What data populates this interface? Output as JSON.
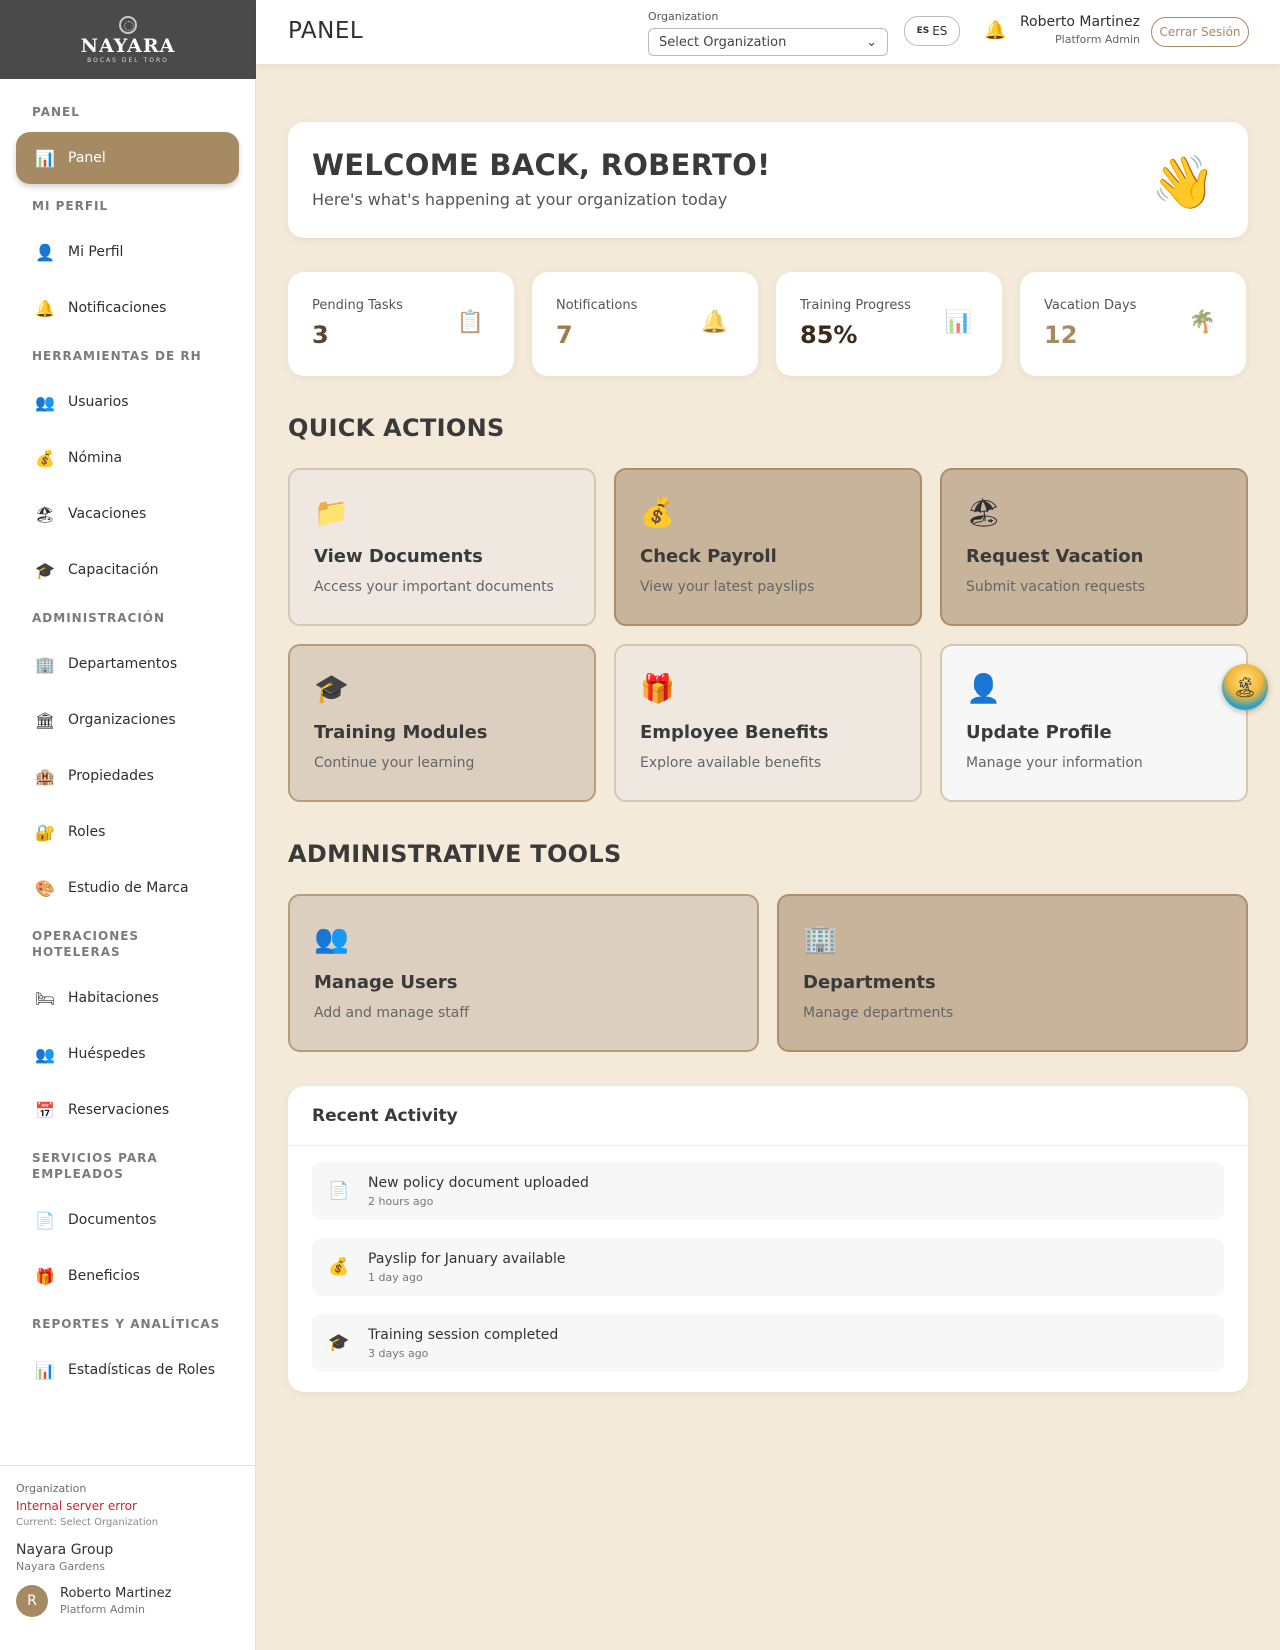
{
  "brand": {
    "name": "NAYARA",
    "sub": "BOCAS DEL TORO"
  },
  "sidebar": {
    "sections": [
      {
        "title": "PANEL",
        "items": [
          {
            "label": "Panel",
            "icon": "📊",
            "active": true
          }
        ]
      },
      {
        "title": "MI PERFIL",
        "items": [
          {
            "label": "Mi Perfil",
            "icon": "👤"
          },
          {
            "label": "Notificaciones",
            "icon": "🔔"
          }
        ]
      },
      {
        "title": "HERRAMIENTAS DE RH",
        "items": [
          {
            "label": "Usuarios",
            "icon": "👥"
          },
          {
            "label": "Nómina",
            "icon": "💰"
          },
          {
            "label": "Vacaciones",
            "icon": "🏖"
          },
          {
            "label": "Capacitación",
            "icon": "🎓"
          }
        ]
      },
      {
        "title": "ADMINISTRACIÓN",
        "items": [
          {
            "label": "Departamentos",
            "icon": "🏢"
          },
          {
            "label": "Organizaciones",
            "icon": "🏛"
          },
          {
            "label": "Propiedades",
            "icon": "🏨"
          },
          {
            "label": "Roles",
            "icon": "🔐"
          },
          {
            "label": "Estudio de Marca",
            "icon": "🎨"
          }
        ]
      },
      {
        "title": "OPERACIONES HOTELERAS",
        "items": [
          {
            "label": "Habitaciones",
            "icon": "🛏"
          },
          {
            "label": "Huéspedes",
            "icon": "👥"
          },
          {
            "label": "Reservaciones",
            "icon": "📅"
          }
        ]
      },
      {
        "title": "SERVICIOS PARA EMPLEADOS",
        "items": [
          {
            "label": "Documentos",
            "icon": "📄"
          },
          {
            "label": "Beneficios",
            "icon": "🎁"
          }
        ]
      },
      {
        "title": "REPORTES Y ANALÍTICAS",
        "items": [
          {
            "label": "Estadísticas de Roles",
            "icon": "📊"
          }
        ]
      }
    ],
    "footer": {
      "org_label": "Organization",
      "error": "Internal server error",
      "current": "Current: Select Organization",
      "group": "Nayara Group",
      "property": "Nayara Gardens",
      "avatar_letter": "R",
      "user_name": "Roberto Martinez",
      "user_role": "Platform Admin"
    }
  },
  "header": {
    "title": "PANEL",
    "org_label": "Organization",
    "org_select": "Select Organization",
    "lang_flag": "ES",
    "lang_code": "ES",
    "user_name": "Roberto Martinez",
    "user_role": "Platform Admin",
    "logout": "Cerrar Sesión"
  },
  "welcome": {
    "title": "WELCOME BACK, ROBERTO!",
    "subtitle": "Here's what's happening at your organization today",
    "icon": "👋"
  },
  "stats": [
    {
      "label": "Pending Tasks",
      "value": "3",
      "icon": "📋",
      "color": "#5a4630"
    },
    {
      "label": "Notifications",
      "value": "7",
      "icon": "🔔",
      "color": "#a07c4a"
    },
    {
      "label": "Training Progress",
      "value": "85%",
      "icon": "📊",
      "color": "#3a2a1a"
    },
    {
      "label": "Vacation Days",
      "value": "12",
      "icon": "🌴",
      "color": "#a68a64"
    }
  ],
  "quick_actions": {
    "title": "QUICK ACTIONS",
    "cards": [
      {
        "title": "View Documents",
        "subtitle": "Access your important documents",
        "icon": "📁",
        "tone": "light"
      },
      {
        "title": "Check Payroll",
        "subtitle": "View your latest payslips",
        "icon": "💰",
        "tone": "dark"
      },
      {
        "title": "Request Vacation",
        "subtitle": "Submit vacation requests",
        "icon": "🏖",
        "tone": "dark"
      },
      {
        "title": "Training Modules",
        "subtitle": "Continue your learning",
        "icon": "🎓",
        "tone": "mid"
      },
      {
        "title": "Employee Benefits",
        "subtitle": "Explore available benefits",
        "icon": "🎁",
        "tone": "light"
      },
      {
        "title": "Update Profile",
        "subtitle": "Manage your information",
        "icon": "👤",
        "tone": "white"
      }
    ]
  },
  "admin_tools": {
    "title": "ADMINISTRATIVE TOOLS",
    "cards": [
      {
        "title": "Manage Users",
        "subtitle": "Add and manage staff",
        "icon": "👥",
        "tone": "mid"
      },
      {
        "title": "Departments",
        "subtitle": "Manage departments",
        "icon": "🏢",
        "tone": "dark"
      }
    ]
  },
  "activity": {
    "title": "Recent Activity",
    "items": [
      {
        "text": "New policy document uploaded",
        "time": "2 hours ago",
        "icon": "📄"
      },
      {
        "text": "Payslip for January available",
        "time": "1 day ago",
        "icon": "💰"
      },
      {
        "text": "Training session completed",
        "time": "3 days ago",
        "icon": "🎓"
      }
    ]
  },
  "floating_icon": "🏝"
}
